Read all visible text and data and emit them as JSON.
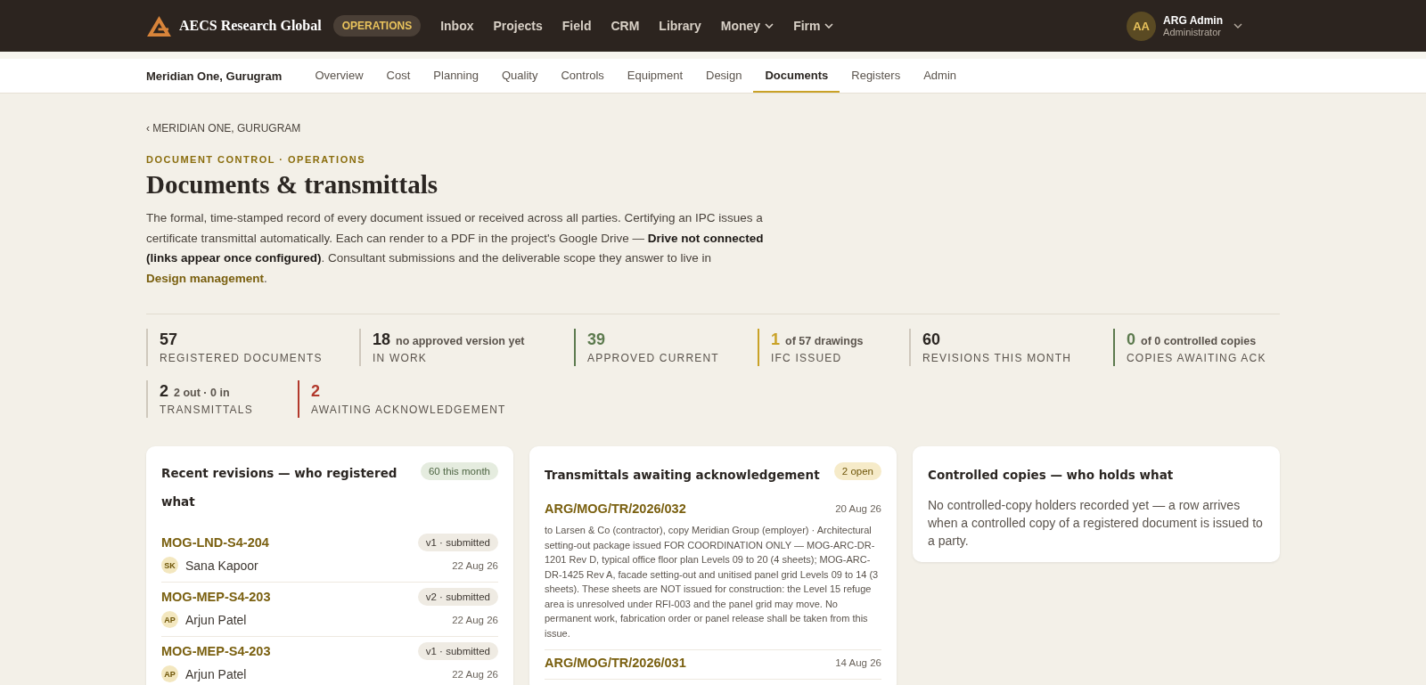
{
  "brand": {
    "name": "AECS Research Global",
    "badge": "OPERATIONS"
  },
  "nav": [
    {
      "label": "Inbox",
      "has_menu": false
    },
    {
      "label": "Projects",
      "has_menu": false
    },
    {
      "label": "Field",
      "has_menu": false
    },
    {
      "label": "CRM",
      "has_menu": false
    },
    {
      "label": "Library",
      "has_menu": false
    },
    {
      "label": "Money",
      "has_menu": true
    },
    {
      "label": "Firm",
      "has_menu": true
    }
  ],
  "user": {
    "initials": "AA",
    "name": "ARG Admin",
    "role": "Administrator"
  },
  "project": "Meridian One, Gurugram",
  "tabs": [
    {
      "label": "Overview",
      "selected": false
    },
    {
      "label": "Cost",
      "selected": false
    },
    {
      "label": "Planning",
      "selected": false
    },
    {
      "label": "Quality",
      "selected": false
    },
    {
      "label": "Controls",
      "selected": false
    },
    {
      "label": "Equipment",
      "selected": false
    },
    {
      "label": "Design",
      "selected": false
    },
    {
      "label": "Documents",
      "selected": true
    },
    {
      "label": "Registers",
      "selected": false
    },
    {
      "label": "Admin",
      "selected": false
    }
  ],
  "breadcrumb": "‹ MERIDIAN ONE, GURUGRAM",
  "eyebrow": "DOCUMENT CONTROL · OPERATIONS",
  "title": "Documents & transmittals",
  "description": {
    "text": "The formal, time-stamped record of every document issued or received across all parties. Certifying an IPC issues a certificate transmittal automatically. Each can render to a PDF in the project's Google Drive — **Drive not connected (links appear once configured)**. Consultant submissions and the deliverable scope they answer to live in ",
    "link": "Design management",
    "after": "."
  },
  "stats": [
    {
      "value": "57",
      "label": "REGISTERED DOCUMENTS"
    },
    {
      "value": "18",
      "note": "no approved version yet",
      "label": "IN WORK"
    },
    {
      "value": "39",
      "label": "APPROVED CURRENT",
      "color": "#5c7a4e"
    },
    {
      "value": "1",
      "note": "of 57 drawings",
      "label": "IFC ISSUED",
      "color": "#c9a227"
    },
    {
      "value": "60",
      "label": "REVISIONS THIS MONTH"
    },
    {
      "value": "0",
      "note": "of 0 controlled copies",
      "label": "COPIES AWAITING ACK",
      "color": "#5c7a4e"
    },
    {
      "value": "2",
      "note": "2 out · 0 in",
      "label": "TRANSMITTALS"
    },
    {
      "value": "2",
      "label": "AWAITING ACKNOWLEDGEMENT",
      "color": "#b2392c"
    }
  ],
  "revisions": {
    "title": "Recent revisions — who registered what",
    "badge": "60 this month",
    "rows": [
      {
        "code": "MOG-LND-S4-204",
        "status": "v1 · submitted",
        "initials": "SK",
        "person": "Sana Kapoor",
        "date": "22 Aug 26"
      },
      {
        "code": "MOG-MEP-S4-203",
        "status": "v2 · submitted",
        "initials": "AP",
        "person": "Arjun Patel",
        "date": "22 Aug 26"
      },
      {
        "code": "MOG-MEP-S4-203",
        "status": "v1 · submitted",
        "initials": "AP",
        "person": "Arjun Patel",
        "date": "22 Aug 26"
      }
    ]
  },
  "transmittals": {
    "title": "Transmittals awaiting acknowledgement",
    "badge": "2 open",
    "rows": [
      {
        "ref": "ARG/MOG/TR/2026/032",
        "date": "20 Aug 26",
        "detail": "to Larsen & Co (contractor), copy Meridian Group (employer) · Architectural setting-out package issued FOR COORDINATION ONLY — MOG-ARC-DR-1201 Rev D, typical office floor plan Levels 09 to 20 (4 sheets); MOG-ARC-DR-1425 Rev A, facade setting-out and unitised panel grid Levels 09 to 14 (3 sheets). These sheets are NOT issued for construction: the Level 15 refuge area is unresolved under RFI-003 and the panel grid may move. No permanent work, fabrication order or panel release shall be taken from this issue."
      },
      {
        "ref": "ARG/MOG/TR/2026/031",
        "date": "14 Aug 26"
      }
    ]
  },
  "copies": {
    "title": "Controlled copies — who holds what",
    "empty": "No controlled-copy holders recorded yet — a row arrives when a controlled copy of a registered document is issued to a party."
  }
}
